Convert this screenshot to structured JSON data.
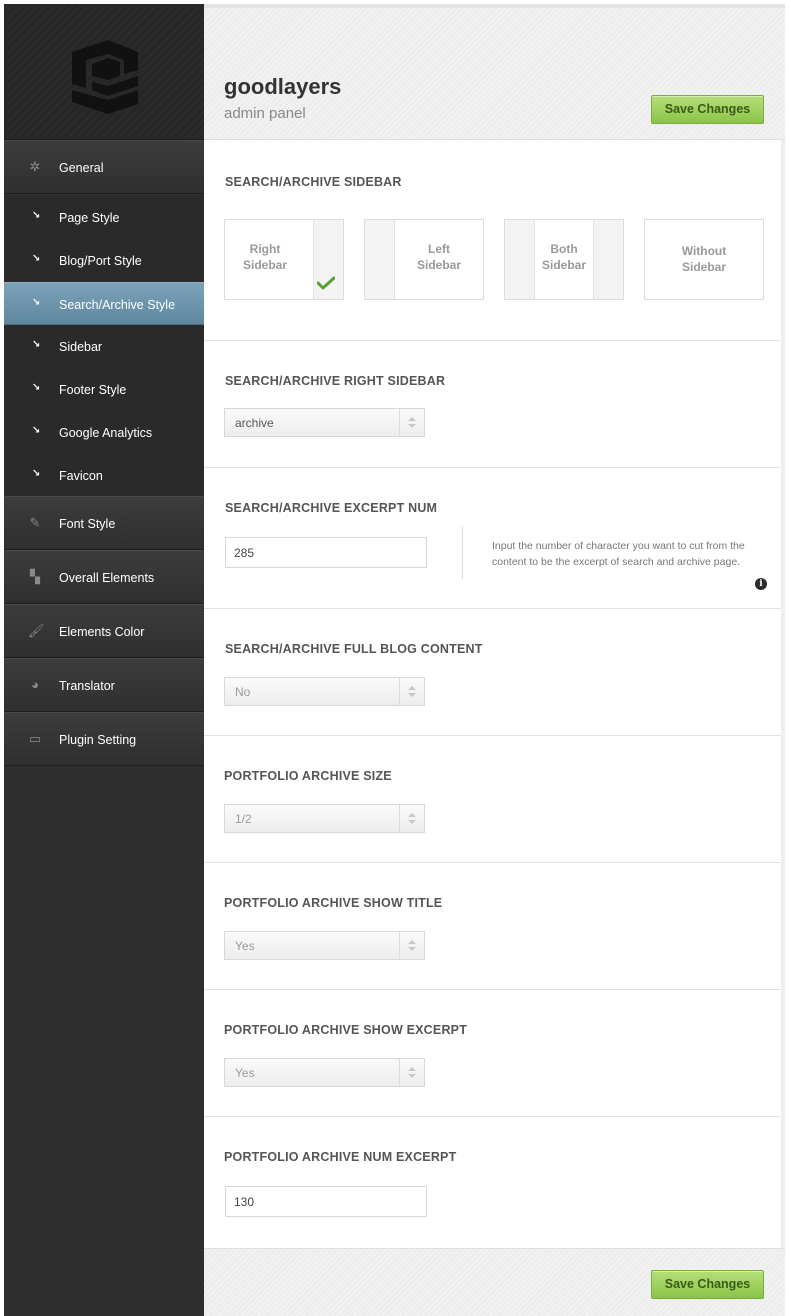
{
  "brand": {
    "title": "goodlayers",
    "subtitle": "admin panel"
  },
  "actions": {
    "save_label": "Save Changes"
  },
  "nav": {
    "main_top": {
      "label": "General",
      "icon": "gear-icon"
    },
    "sub_items": [
      {
        "label": "Page Style",
        "active": false
      },
      {
        "label": "Blog/Port Style",
        "active": false
      },
      {
        "label": "Search/Archive Style",
        "active": true
      },
      {
        "label": "Sidebar",
        "active": false
      },
      {
        "label": "Footer Style",
        "active": false
      },
      {
        "label": "Google Analytics",
        "active": false
      },
      {
        "label": "Favicon",
        "active": false
      }
    ],
    "main_bottom": [
      {
        "label": "Font Style",
        "icon": "pencil-icon"
      },
      {
        "label": "Overall Elements",
        "icon": "layout-blocks-icon"
      },
      {
        "label": "Elements Color",
        "icon": "paint-brush-icon"
      },
      {
        "label": "Translator",
        "icon": "pie-chart-icon"
      },
      {
        "label": "Plugin Setting",
        "icon": "monitor-icon"
      }
    ]
  },
  "sections": {
    "sidebar_layout": {
      "title": "SEARCH/ARCHIVE SIDEBAR",
      "options": [
        {
          "label_line1": "Right",
          "label_line2": "Sidebar",
          "selected": true
        },
        {
          "label_line1": "Left",
          "label_line2": "Sidebar",
          "selected": false
        },
        {
          "label_line1": "Both",
          "label_line2": "Sidebar",
          "selected": false
        },
        {
          "label_line1": "Without",
          "label_line2": "Sidebar",
          "selected": false
        }
      ]
    },
    "right_sidebar": {
      "title": "SEARCH/ARCHIVE RIGHT SIDEBAR",
      "value": "archive"
    },
    "excerpt_num": {
      "title": "SEARCH/ARCHIVE EXCERPT NUM",
      "value": "285",
      "help_line1": "Input the number of character you want to cut from the",
      "help_line2": "content to be the excerpt of search and archive page."
    },
    "full_blog": {
      "title": "SEARCH/ARCHIVE FULL BLOG CONTENT",
      "value": "No"
    },
    "portfolio_size": {
      "title": "PORTFOLIO ARCHIVE SIZE",
      "value": "1/2"
    },
    "portfolio_show_title": {
      "title": "PORTFOLIO ARCHIVE SHOW TITLE",
      "value": "Yes"
    },
    "portfolio_show_excerpt": {
      "title": "PORTFOLIO ARCHIVE SHOW EXCERPT",
      "value": "Yes"
    },
    "portfolio_num_excerpt": {
      "title": "PORTFOLIO ARCHIVE NUM EXCERPT",
      "value": "130"
    }
  },
  "colors": {
    "accent_green": "#8cc34a",
    "active_nav": "#6d94aa",
    "sidebar_bg": "#2e2e2e",
    "check_green": "#5aa02c"
  }
}
